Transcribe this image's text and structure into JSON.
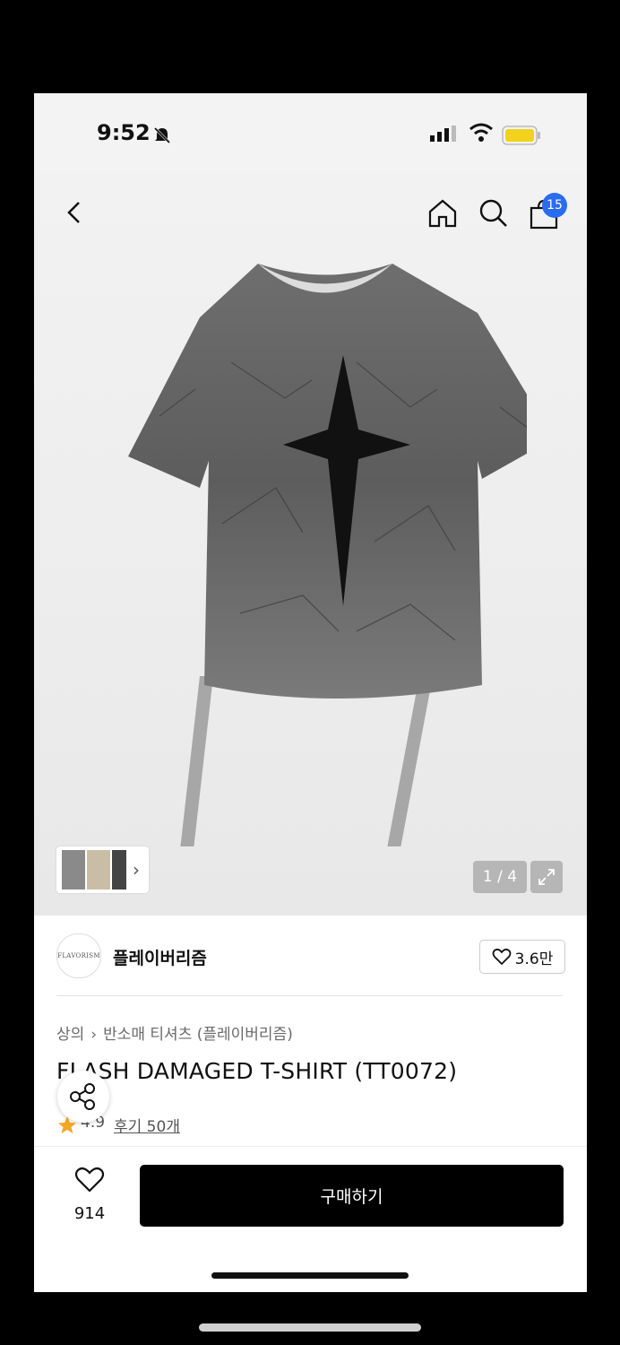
{
  "status": {
    "time": "9:52"
  },
  "header": {
    "cart_count": "15"
  },
  "gallery": {
    "counter": "1 / 4"
  },
  "brand": {
    "logo_text": "FLAVORISM",
    "name": "플레이버리즘",
    "likes": "3.6만"
  },
  "product": {
    "breadcrumb": [
      "상의",
      "반소매 티셔츠 (플레이버리즘)"
    ],
    "title": "FLASH DAMAGED T-SHIRT (TT0072)",
    "rating": "4.9",
    "reviews": "후기 50개"
  },
  "actions": {
    "wish_count": "914",
    "buy_label": "구매하기"
  },
  "colors": {
    "cart_badge": "#2a6cf0",
    "buy_button": "#000000",
    "star": "#f5a623"
  }
}
